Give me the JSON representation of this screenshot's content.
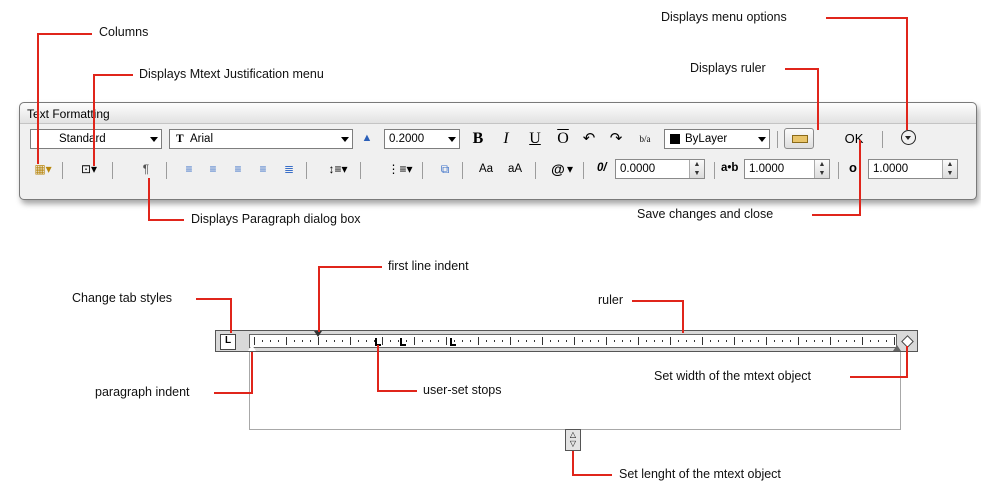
{
  "annotations": {
    "columns": "Columns",
    "justification": "Displays Mtext Justification menu",
    "menu_options": "Displays menu options",
    "ruler_toggle": "Displays ruler",
    "paragraph_dialog": "Displays Paragraph dialog box",
    "save_close": "Save changes and close",
    "first_line_indent": "first line indent",
    "change_tab_styles": "Change tab styles",
    "ruler": "ruler",
    "paragraph_indent": "paragraph indent",
    "user_set_stops": "user-set stops",
    "set_width": "Set width of the mtext object",
    "set_length": "Set lenght of the mtext object"
  },
  "toolbar": {
    "title": "Text Formatting",
    "style": "Standard",
    "font": "Arial",
    "font_prefix": "T",
    "text_height": "0.2000",
    "bold": "B",
    "italic": "I",
    "underline": "U",
    "overline": "O",
    "undo": "↶",
    "redo": "↷",
    "stack": "b/a",
    "color": "ByLayer",
    "ok": "OK",
    "change_case_upper": "Aa",
    "change_case_lower": "aA",
    "symbol": "@",
    "oblique_label": "0/",
    "oblique_value": "0.0000",
    "tracking_label": "a•b",
    "tracking_value": "1.0000",
    "width_label": "o",
    "width_value": "1.0000"
  },
  "colors": {
    "annotation_line": "#e0251b",
    "color_swatch": "#000000"
  }
}
